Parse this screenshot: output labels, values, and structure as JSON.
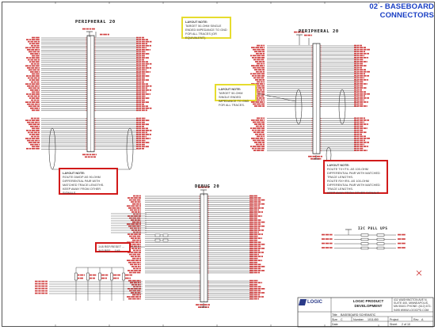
{
  "sheet_title": "02 - BASEBOARD CONNECTORS",
  "connectors": {
    "top_left": "PERIPHERAL 20",
    "top_right": "PERIPHERAL 20",
    "bottom": "DEBUG 20",
    "pullups": "I2C PULL UPS"
  },
  "notes": {
    "yellow_top": {
      "header": "LAYOUT NOTE:",
      "body": "TARGET 50-OHM SINGLE ENDED IMPEDANCE TO GND FOR ALL TRACES (OR EQUIVALENT)."
    },
    "yellow_mid": {
      "header": "LAYOUT NOTE:",
      "body": "TARGET 50-OHM SINGLE ENDED IMPEDANCE TO GND FOR ALL TRACES."
    },
    "red_left": {
      "header": "LAYOUT NOTE:",
      "body": "ROUTE DM/DP AS 90-OHM DIFFERENTIAL PAIR WITH MATCHED TRACE LENGTHS.",
      "body2": "KEEP AWAY FROM OTHER SIGNALS."
    },
    "red_right": {
      "header": "LAYOUT NOTE:",
      "body": "ROUTE TX+/TX- AS 100-OHM DIFFERENTIAL PAIR WITH MATCHED TRACE LENGTHS.",
      "body2": "ROUTE RX+/RX- AS 100-OHM DIFFERENTIAL PAIR WITH MATCHED TRACE LENGTHS.",
      "body3": "KEEP AWAY FROM OTHER SIGNALS."
    },
    "red_bottom": {
      "body": "1V8 REF/RESET ... 3V3 REF ... 1V8"
    }
  },
  "title_block": {
    "logo": "LOGIC",
    "company": "LOGIC PRODUCT DEVELOPMENT",
    "address": "411 WASHINGTON AVE N, SUITE 400, MINNEAPOLIS, MN 55401 PHONE: (612) 672-9495 WWW.LOGICPD.COM",
    "title_label": "Title",
    "title_value": "BASEBOARD SCHEMATIC",
    "size_label": "Size",
    "size_value": "C",
    "number_label": "Number",
    "number_value": "1011450",
    "rev_label": "Rev",
    "rev_value": "A",
    "project_label": "Project",
    "date_label": "Date",
    "sheet_label": "Sheet",
    "sheet_value": "2 of 10"
  },
  "colors": {
    "title_blue": "#1a3fc4",
    "net_red": "#c81e1e",
    "wire_black": "#1a1a1a",
    "note_red": "#d11a1a",
    "note_yellow": "#e6dc2e"
  }
}
